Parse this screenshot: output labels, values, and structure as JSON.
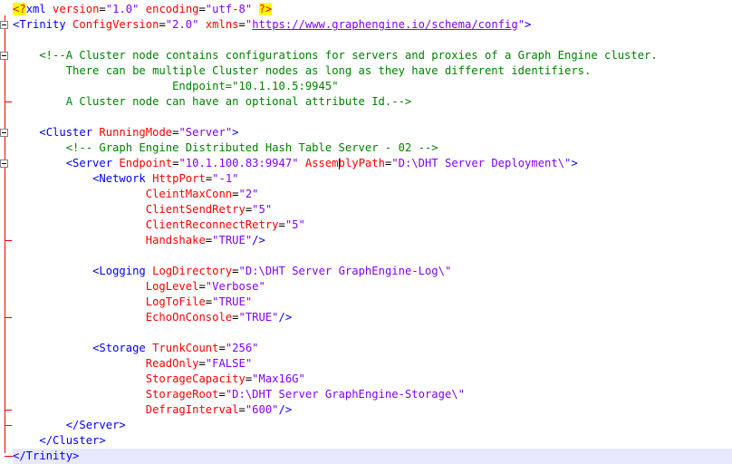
{
  "editor": {
    "lines": [
      [
        {
          "t": "<?",
          "c": "decl-mark"
        },
        {
          "t": "xml ",
          "c": "tag"
        },
        {
          "t": "version",
          "c": "attr"
        },
        {
          "t": "=",
          "c": "eq"
        },
        {
          "t": "\"1.0\"",
          "c": "val"
        },
        {
          "t": " ",
          "c": "eq"
        },
        {
          "t": "encoding",
          "c": "attr"
        },
        {
          "t": "=",
          "c": "eq"
        },
        {
          "t": "\"utf-8\"",
          "c": "val"
        },
        {
          "t": " ",
          "c": "eq"
        },
        {
          "t": "?>",
          "c": "decl-mark"
        }
      ],
      [
        {
          "t": "<Trinity ",
          "c": "tag"
        },
        {
          "t": "ConfigVersion",
          "c": "attr"
        },
        {
          "t": "=",
          "c": "eq"
        },
        {
          "t": "\"2.0\"",
          "c": "val"
        },
        {
          "t": " ",
          "c": "eq"
        },
        {
          "t": "xmlns",
          "c": "attr"
        },
        {
          "t": "=",
          "c": "eq"
        },
        {
          "t": "\"",
          "c": "val"
        },
        {
          "t": "https://www.graphengine.io/schema/config",
          "c": "url"
        },
        {
          "t": "\"",
          "c": "val"
        },
        {
          "t": ">",
          "c": "tag"
        }
      ],
      [],
      [
        {
          "t": "    <!--A Cluster node contains configurations for servers and proxies of a Graph Engine cluster.",
          "c": "cmt"
        }
      ],
      [
        {
          "t": "        There can be multiple Cluster nodes as long as they have different identifiers.",
          "c": "cmt"
        }
      ],
      [
        {
          "t": "                        Endpoint=\"10.1.10.5:9945\"",
          "c": "cmt"
        }
      ],
      [
        {
          "t": "        A Cluster node can have an optional attribute Id.-->",
          "c": "cmt"
        }
      ],
      [],
      [
        {
          "t": "    ",
          "c": "eq"
        },
        {
          "t": "<Cluster ",
          "c": "tag"
        },
        {
          "t": "RunningMode",
          "c": "attr"
        },
        {
          "t": "=",
          "c": "eq"
        },
        {
          "t": "\"Server\"",
          "c": "val"
        },
        {
          "t": ">",
          "c": "tag"
        }
      ],
      [
        {
          "t": "        <!-- Graph Engine Distributed Hash Table Server - 02 -->",
          "c": "cmt"
        }
      ],
      [
        {
          "t": "        ",
          "c": "eq"
        },
        {
          "t": "<Server ",
          "c": "tag"
        },
        {
          "t": "Endpoint",
          "c": "attr"
        },
        {
          "t": "=",
          "c": "eq"
        },
        {
          "t": "\"10.1.100.83:9947\"",
          "c": "val"
        },
        {
          "t": " ",
          "c": "eq"
        },
        {
          "t": "AssemblyPath",
          "c": "attr"
        },
        {
          "t": "=",
          "c": "eq"
        },
        {
          "t": "\"D:\\DHT Server Deployment\\\"",
          "c": "val"
        },
        {
          "t": ">",
          "c": "tag"
        }
      ],
      [
        {
          "t": "            ",
          "c": "eq"
        },
        {
          "t": "<Network ",
          "c": "tag"
        },
        {
          "t": "HttpPort",
          "c": "attr"
        },
        {
          "t": "=",
          "c": "eq"
        },
        {
          "t": "\"-1\"",
          "c": "val"
        }
      ],
      [
        {
          "t": "                    ",
          "c": "eq"
        },
        {
          "t": "CleintMaxConn",
          "c": "attr"
        },
        {
          "t": "=",
          "c": "eq"
        },
        {
          "t": "\"2\"",
          "c": "val"
        }
      ],
      [
        {
          "t": "                    ",
          "c": "eq"
        },
        {
          "t": "ClientSendRetry",
          "c": "attr"
        },
        {
          "t": "=",
          "c": "eq"
        },
        {
          "t": "\"5\"",
          "c": "val"
        }
      ],
      [
        {
          "t": "                    ",
          "c": "eq"
        },
        {
          "t": "ClientReconnectRetry",
          "c": "attr"
        },
        {
          "t": "=",
          "c": "eq"
        },
        {
          "t": "\"5\"",
          "c": "val"
        }
      ],
      [
        {
          "t": "                    ",
          "c": "eq"
        },
        {
          "t": "Handshake",
          "c": "attr"
        },
        {
          "t": "=",
          "c": "eq"
        },
        {
          "t": "\"TRUE\"",
          "c": "val"
        },
        {
          "t": "/>",
          "c": "tag"
        }
      ],
      [],
      [
        {
          "t": "            ",
          "c": "eq"
        },
        {
          "t": "<Logging ",
          "c": "tag"
        },
        {
          "t": "LogDirectory",
          "c": "attr"
        },
        {
          "t": "=",
          "c": "eq"
        },
        {
          "t": "\"D:\\DHT Server GraphEngine-Log\\\"",
          "c": "val"
        }
      ],
      [
        {
          "t": "                    ",
          "c": "eq"
        },
        {
          "t": "LogLevel",
          "c": "attr"
        },
        {
          "t": "=",
          "c": "eq"
        },
        {
          "t": "\"Verbose\"",
          "c": "val"
        }
      ],
      [
        {
          "t": "                    ",
          "c": "eq"
        },
        {
          "t": "LogToFile",
          "c": "attr"
        },
        {
          "t": "=",
          "c": "eq"
        },
        {
          "t": "\"TRUE\"",
          "c": "val"
        }
      ],
      [
        {
          "t": "                    ",
          "c": "eq"
        },
        {
          "t": "EchoOnConsole",
          "c": "attr"
        },
        {
          "t": "=",
          "c": "eq"
        },
        {
          "t": "\"TRUE\"",
          "c": "val"
        },
        {
          "t": "/>",
          "c": "tag"
        }
      ],
      [],
      [
        {
          "t": "            ",
          "c": "eq"
        },
        {
          "t": "<Storage ",
          "c": "tag"
        },
        {
          "t": "TrunkCount",
          "c": "attr"
        },
        {
          "t": "=",
          "c": "eq"
        },
        {
          "t": "\"256\"",
          "c": "val"
        }
      ],
      [
        {
          "t": "                    ",
          "c": "eq"
        },
        {
          "t": "ReadOnly",
          "c": "attr"
        },
        {
          "t": "=",
          "c": "eq"
        },
        {
          "t": "\"FALSE\"",
          "c": "val"
        }
      ],
      [
        {
          "t": "                    ",
          "c": "eq"
        },
        {
          "t": "StorageCapacity",
          "c": "attr"
        },
        {
          "t": "=",
          "c": "eq"
        },
        {
          "t": "\"Max16G\"",
          "c": "val"
        }
      ],
      [
        {
          "t": "                    ",
          "c": "eq"
        },
        {
          "t": "StorageRoot",
          "c": "attr"
        },
        {
          "t": "=",
          "c": "eq"
        },
        {
          "t": "\"D:\\DHT Server GraphEngine-Storage\\\"",
          "c": "val"
        }
      ],
      [
        {
          "t": "                    ",
          "c": "eq"
        },
        {
          "t": "DefragInterval",
          "c": "attr"
        },
        {
          "t": "=",
          "c": "eq"
        },
        {
          "t": "\"600\"",
          "c": "val"
        },
        {
          "t": "/>",
          "c": "tag"
        }
      ],
      [
        {
          "t": "        ",
          "c": "eq"
        },
        {
          "t": "</Server>",
          "c": "tag"
        }
      ],
      [
        {
          "t": "    ",
          "c": "eq"
        },
        {
          "t": "</Cluster>",
          "c": "tag"
        }
      ],
      [
        {
          "t": "</Trinity>",
          "c": "tag"
        }
      ]
    ],
    "current_line": 29,
    "colors": {
      "tag": "#0000ff",
      "attribute": "#ff0000",
      "value": "#8000ff",
      "comment": "#008000",
      "declaration_highlight": "#ffff00",
      "current_line": "#e8e8ff",
      "fold_margin": "#ff0000"
    }
  }
}
